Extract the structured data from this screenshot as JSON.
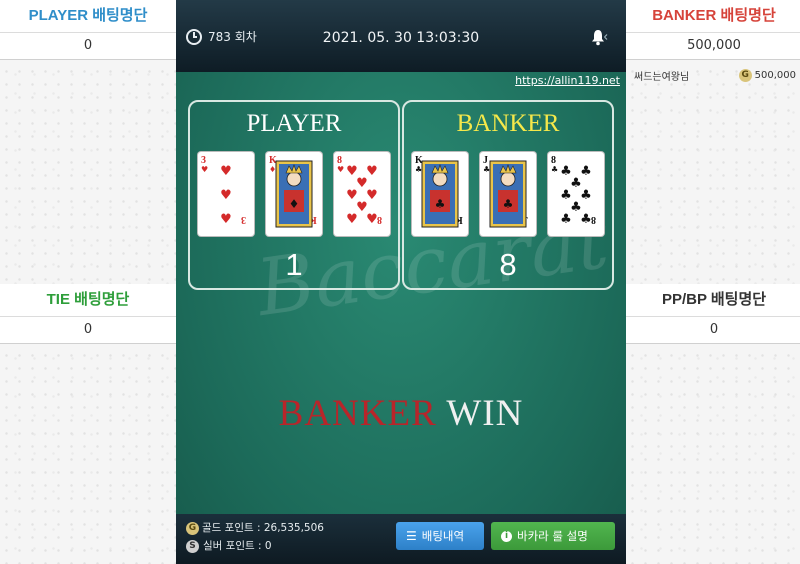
{
  "left_top": {
    "title": "PLAYER 배팅명단",
    "title_color": "#2f8ec9",
    "value": "0"
  },
  "left_bottom": {
    "title": "TIE 배팅명단",
    "title_color": "#2e9e3a",
    "value": "0"
  },
  "right_top": {
    "title": "BANKER 배팅명단",
    "title_color": "#d6433a",
    "value": "500,000",
    "bettors": [
      {
        "name": "써드는여왕님",
        "badge": "G",
        "amount": "500,000"
      }
    ]
  },
  "right_bottom": {
    "title": "PP/BP 배팅명단",
    "title_color": "#333333",
    "value": "0"
  },
  "header": {
    "round": "783 회차",
    "datetime": "2021. 05. 30 13:03:30",
    "url": "https://allin119.net"
  },
  "table": {
    "watermark": "Baccarat",
    "player": {
      "title": "PLAYER",
      "score": "1",
      "cards": [
        {
          "rank": "3",
          "suit": "♥",
          "color": "#d42a2a"
        },
        {
          "rank": "K",
          "suit": "♦",
          "color": "#d42a2a"
        },
        {
          "rank": "8",
          "suit": "♥",
          "color": "#d42a2a"
        }
      ]
    },
    "banker": {
      "title": "BANKER",
      "score": "8",
      "cards": [
        {
          "rank": "K",
          "suit": "♣",
          "color": "#111111"
        },
        {
          "rank": "J",
          "suit": "♣",
          "color": "#111111"
        },
        {
          "rank": "8",
          "suit": "♣",
          "color": "#111111"
        }
      ]
    },
    "result": {
      "word1": "BANKER",
      "word2": "WIN"
    }
  },
  "footer": {
    "gold_badge": "G",
    "gold_label": "골드 포인트 : 26,535,506",
    "silver_badge": "S",
    "silver_label": "실버 포인트 : 0",
    "bet_history_label": "배팅내역",
    "rules_label": "바카라 룰 설명"
  }
}
